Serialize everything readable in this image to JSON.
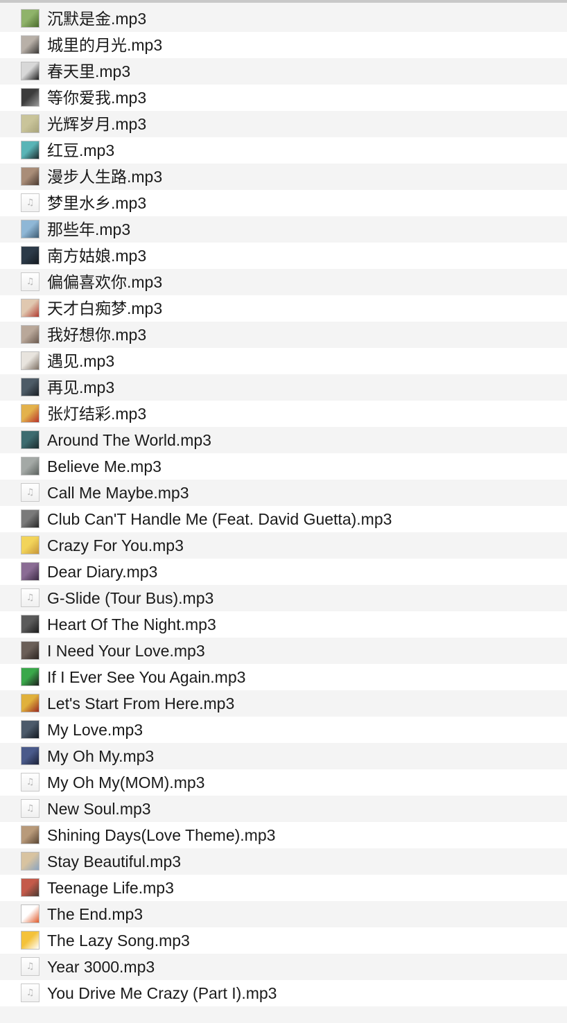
{
  "files": [
    {
      "name": "沉默是金.mp3",
      "thumb": {
        "icon": "album-art-icon",
        "colors": [
          "#8fb36a",
          "#4a6b2c"
        ]
      }
    },
    {
      "name": "城里的月光.mp3",
      "thumb": {
        "icon": "album-art-icon",
        "colors": [
          "#b8b0a8",
          "#3a3836"
        ]
      }
    },
    {
      "name": "春天里.mp3",
      "thumb": {
        "icon": "album-art-icon",
        "colors": [
          "#d8d8d8",
          "#1e1e1e"
        ]
      }
    },
    {
      "name": "等你爱我.mp3",
      "thumb": {
        "icon": "album-art-icon",
        "colors": [
          "#3c3c3c",
          "#9a9a9a"
        ]
      }
    },
    {
      "name": "光辉岁月.mp3",
      "thumb": {
        "icon": "album-art-icon",
        "colors": [
          "#c9c49a",
          "#a8a37a"
        ]
      }
    },
    {
      "name": "红豆.mp3",
      "thumb": {
        "icon": "album-art-icon",
        "colors": [
          "#5ab4b6",
          "#1c2a2c"
        ]
      }
    },
    {
      "name": "漫步人生路.mp3",
      "thumb": {
        "icon": "album-art-icon",
        "colors": [
          "#a98d78",
          "#4a3a30"
        ]
      }
    },
    {
      "name": "梦里水乡.mp3",
      "thumb": {
        "icon": "music-note-icon",
        "generic": true
      }
    },
    {
      "name": "那些年.mp3",
      "thumb": {
        "icon": "album-art-icon",
        "colors": [
          "#8fb7d6",
          "#3f5c73"
        ]
      }
    },
    {
      "name": "南方姑娘.mp3",
      "thumb": {
        "icon": "album-art-icon",
        "colors": [
          "#2c3a48",
          "#151b21"
        ]
      }
    },
    {
      "name": "偏偏喜欢你.mp3",
      "thumb": {
        "icon": "music-note-icon",
        "generic": true
      }
    },
    {
      "name": "天才白痴梦.mp3",
      "thumb": {
        "icon": "album-art-icon",
        "colors": [
          "#e0c8b0",
          "#b03a30"
        ]
      }
    },
    {
      "name": "我好想你.mp3",
      "thumb": {
        "icon": "album-art-icon",
        "colors": [
          "#b9a89a",
          "#6b5a4f"
        ]
      }
    },
    {
      "name": "遇见.mp3",
      "thumb": {
        "icon": "album-art-icon",
        "colors": [
          "#e8e4de",
          "#7c6f63"
        ]
      }
    },
    {
      "name": "再见.mp3",
      "thumb": {
        "icon": "album-art-icon",
        "colors": [
          "#4d5b66",
          "#1a1f24"
        ]
      }
    },
    {
      "name": "张灯结彩.mp3",
      "thumb": {
        "icon": "album-art-icon",
        "colors": [
          "#e3b24c",
          "#b8342a"
        ]
      }
    },
    {
      "name": "Around The World.mp3",
      "thumb": {
        "icon": "album-art-icon",
        "colors": [
          "#3d6b6f",
          "#1a2a2c"
        ]
      }
    },
    {
      "name": "Believe Me.mp3",
      "thumb": {
        "icon": "album-art-icon",
        "colors": [
          "#a4a9a6",
          "#5c625f"
        ]
      }
    },
    {
      "name": "Call Me Maybe.mp3",
      "thumb": {
        "icon": "music-note-icon",
        "generic": true
      }
    },
    {
      "name": "Club Can'T Handle Me (Feat. David Guetta).mp3",
      "thumb": {
        "icon": "album-art-icon",
        "colors": [
          "#7a7a7a",
          "#262626"
        ]
      }
    },
    {
      "name": "Crazy For You.mp3",
      "thumb": {
        "icon": "album-art-icon",
        "colors": [
          "#f2d45a",
          "#c7963a"
        ]
      }
    },
    {
      "name": "Dear Diary.mp3",
      "thumb": {
        "icon": "album-art-icon",
        "colors": [
          "#8a6c94",
          "#3b2a44"
        ]
      }
    },
    {
      "name": "G-Slide (Tour Bus).mp3",
      "thumb": {
        "icon": "music-note-icon",
        "generic": true
      }
    },
    {
      "name": "Heart Of The Night.mp3",
      "thumb": {
        "icon": "album-art-icon",
        "colors": [
          "#5a5a5a",
          "#1c1c1c"
        ]
      }
    },
    {
      "name": "I Need Your Love.mp3",
      "thumb": {
        "icon": "album-art-icon",
        "colors": [
          "#6a5f58",
          "#2a2320"
        ]
      }
    },
    {
      "name": "If I Ever See You Again.mp3",
      "thumb": {
        "icon": "album-art-icon",
        "colors": [
          "#3aa84a",
          "#1d1d1d"
        ]
      }
    },
    {
      "name": "Let's Start From Here.mp3",
      "thumb": {
        "icon": "album-art-icon",
        "colors": [
          "#e0b13c",
          "#9a2a22"
        ]
      }
    },
    {
      "name": "My Love.mp3",
      "thumb": {
        "icon": "album-art-icon",
        "colors": [
          "#4c5a6a",
          "#121820"
        ]
      }
    },
    {
      "name": "My Oh My.mp3",
      "thumb": {
        "icon": "album-art-icon",
        "colors": [
          "#4a5a8a",
          "#1c2238"
        ]
      }
    },
    {
      "name": "My Oh My(MOM).mp3",
      "thumb": {
        "icon": "music-note-icon",
        "generic": true
      }
    },
    {
      "name": "New Soul.mp3",
      "thumb": {
        "icon": "music-note-icon",
        "generic": true
      }
    },
    {
      "name": "Shining Days(Love Theme).mp3",
      "thumb": {
        "icon": "album-art-icon",
        "colors": [
          "#b89a7a",
          "#5a4634"
        ]
      }
    },
    {
      "name": "Stay Beautiful.mp3",
      "thumb": {
        "icon": "album-art-icon",
        "colors": [
          "#d8c3a0",
          "#8aa4c0"
        ]
      }
    },
    {
      "name": "Teenage Life.mp3",
      "thumb": {
        "icon": "album-art-icon",
        "colors": [
          "#c45a4a",
          "#4a3a32"
        ]
      }
    },
    {
      "name": "The End.mp3",
      "thumb": {
        "icon": "album-art-icon",
        "colors": [
          "#ffffff",
          "#e05a2a"
        ]
      }
    },
    {
      "name": "The Lazy Song.mp3",
      "thumb": {
        "icon": "album-art-icon",
        "colors": [
          "#f4c23a",
          "#ffffff"
        ]
      }
    },
    {
      "name": "Year 3000.mp3",
      "thumb": {
        "icon": "music-note-icon",
        "generic": true
      }
    },
    {
      "name": "You Drive Me Crazy (Part I).mp3",
      "thumb": {
        "icon": "music-note-icon",
        "generic": true
      }
    }
  ]
}
